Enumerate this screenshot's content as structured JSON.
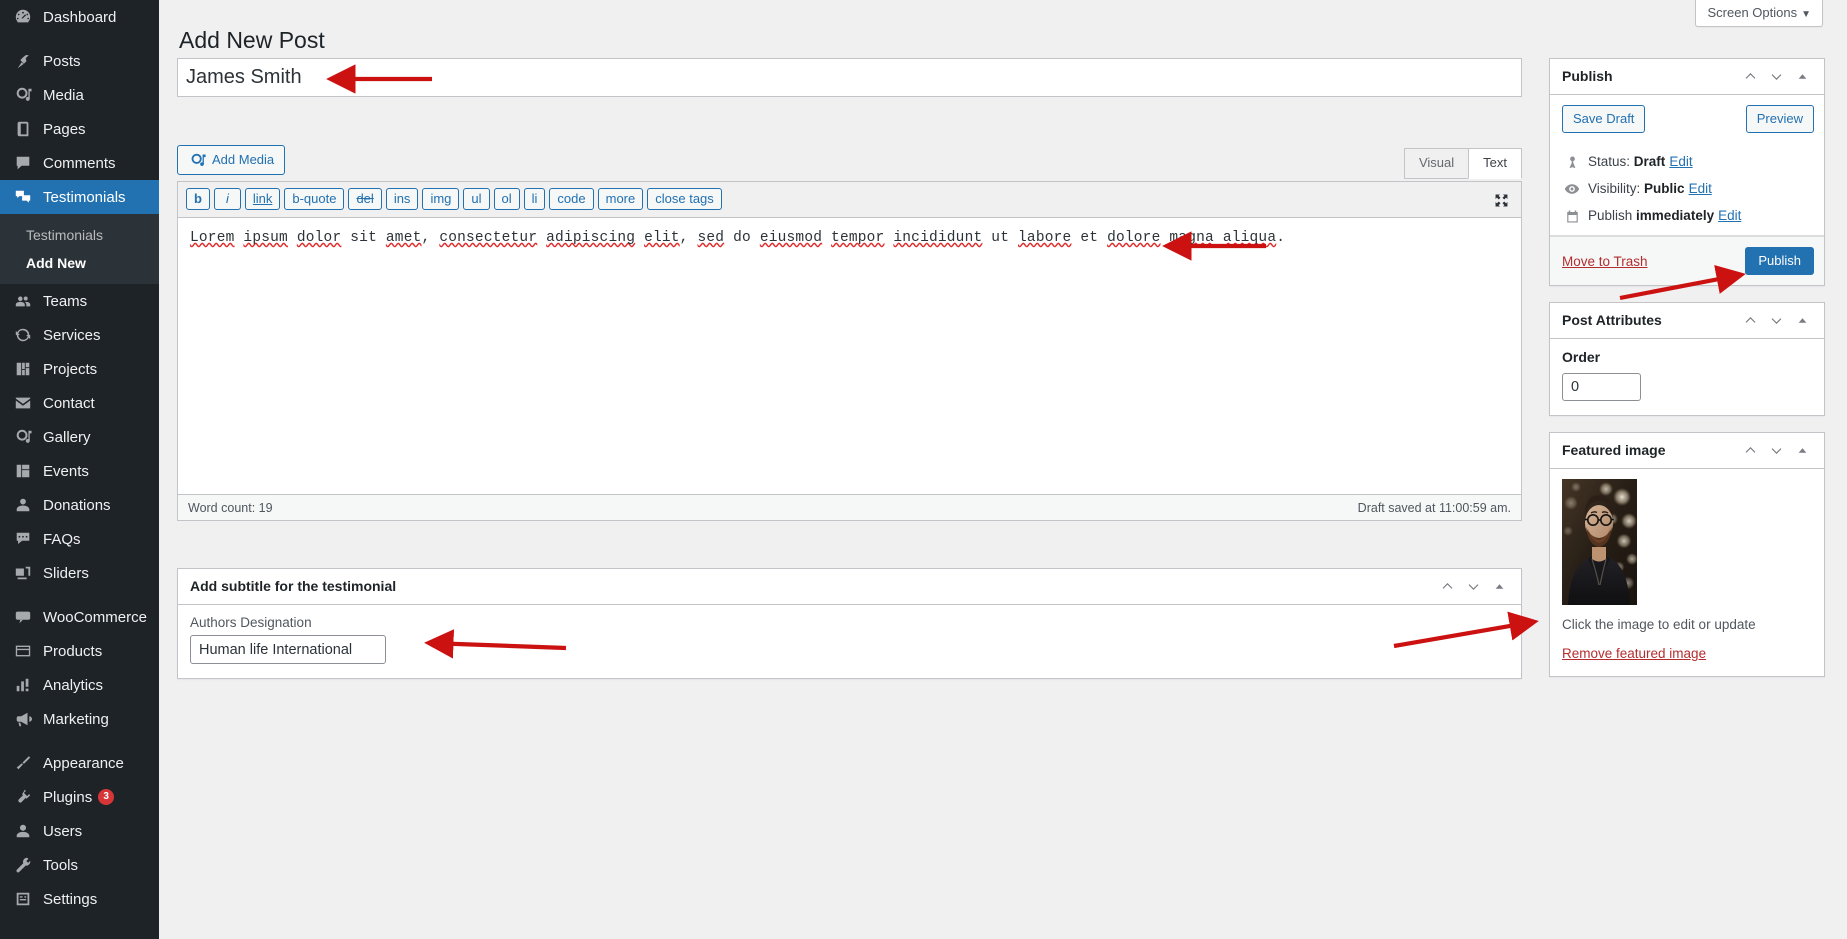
{
  "colors": {
    "sidebar_bg": "#1d2327",
    "submenu_bg": "#2c3338",
    "accent_blue": "#2271b1",
    "danger_red": "#b32d2e",
    "badge_red": "#d63638",
    "annotation_red": "#cc1111",
    "page_bg": "#f0f0f1"
  },
  "sidebar": {
    "items": [
      {
        "label": "Dashboard",
        "icon": "dashboard-icon",
        "current": false
      },
      {
        "sep": true
      },
      {
        "label": "Posts",
        "icon": "pin-icon",
        "current": false
      },
      {
        "label": "Media",
        "icon": "media-icon",
        "current": false
      },
      {
        "label": "Pages",
        "icon": "pages-icon",
        "current": false
      },
      {
        "label": "Comments",
        "icon": "comments-icon",
        "current": false
      },
      {
        "label": "Testimonials",
        "icon": "testimonials-icon",
        "current": true
      },
      {
        "label": "Teams",
        "icon": "teams-icon",
        "current": false
      },
      {
        "label": "Services",
        "icon": "services-icon",
        "current": false
      },
      {
        "label": "Projects",
        "icon": "projects-icon",
        "current": false
      },
      {
        "label": "Contact",
        "icon": "mail-icon",
        "current": false
      },
      {
        "label": "Gallery",
        "icon": "gallery-icon",
        "current": false
      },
      {
        "label": "Events",
        "icon": "events-icon",
        "current": false
      },
      {
        "label": "Donations",
        "icon": "donations-icon",
        "current": false
      },
      {
        "label": "FAQs",
        "icon": "faqs-icon",
        "current": false
      },
      {
        "label": "Sliders",
        "icon": "sliders-icon",
        "current": false
      },
      {
        "sep": true
      },
      {
        "label": "WooCommerce",
        "icon": "woocommerce-icon",
        "current": false
      },
      {
        "label": "Products",
        "icon": "products-icon",
        "current": false
      },
      {
        "label": "Analytics",
        "icon": "analytics-icon",
        "current": false
      },
      {
        "label": "Marketing",
        "icon": "marketing-icon",
        "current": false
      },
      {
        "sep": true
      },
      {
        "label": "Appearance",
        "icon": "appearance-icon",
        "current": false
      },
      {
        "label": "Plugins",
        "icon": "plugins-icon",
        "current": false,
        "badge": "3"
      },
      {
        "label": "Users",
        "icon": "users-icon",
        "current": false
      },
      {
        "label": "Tools",
        "icon": "tools-icon",
        "current": false
      },
      {
        "label": "Settings",
        "icon": "settings-icon",
        "current": false
      }
    ],
    "submenu": {
      "parent": "Testimonials",
      "items": [
        {
          "label": "Testimonials",
          "current": false
        },
        {
          "label": "Add New",
          "current": true
        }
      ]
    }
  },
  "screen_options": {
    "label": "Screen Options",
    "caret": "▼"
  },
  "page": {
    "title": "Add New Post"
  },
  "title_field": {
    "value": "James Smith",
    "placeholder": "Add title"
  },
  "editor": {
    "add_media_label": "Add Media",
    "tabs": [
      {
        "label": "Visual",
        "active": false
      },
      {
        "label": "Text",
        "active": true
      }
    ],
    "quicktags": [
      "b",
      "i",
      "link",
      "b-quote",
      "del",
      "ins",
      "img",
      "ul",
      "ol",
      "li",
      "code",
      "more",
      "close tags"
    ],
    "content": "Lorem ipsum dolor sit amet, consectetur adipiscing elit, sed do eiusmod tempor incididunt ut labore et dolore magna aliqua.",
    "word_count": "Word count: 19",
    "draft_saved": "Draft saved at 11:00:59 am.",
    "fullscreen_icon": "fullscreen-icon"
  },
  "subtitle_box": {
    "title": "Add subtitle for the testimonial",
    "field_label": "Authors Designation",
    "field_value": "Human life International"
  },
  "publish_box": {
    "title": "Publish",
    "save_draft_label": "Save Draft",
    "preview_label": "Preview",
    "status_label": "Status:",
    "status_value": "Draft",
    "status_edit": "Edit",
    "visibility_label": "Visibility:",
    "visibility_value": "Public",
    "visibility_edit": "Edit",
    "publish_label": "Publish",
    "publish_value": "immediately",
    "publish_edit": "Edit",
    "trash_label": "Move to Trash",
    "publish_button": "Publish"
  },
  "post_attributes": {
    "title": "Post Attributes",
    "order_label": "Order",
    "order_value": "0"
  },
  "featured_image": {
    "title": "Featured image",
    "hint": "Click the image to edit or update",
    "remove_label": "Remove featured image",
    "alt": "portrait of bearded man with glasses in front of bokeh lights"
  },
  "annotations": [
    {
      "name": "arrow-to-title",
      "target": "title-field"
    },
    {
      "name": "arrow-to-content",
      "target": "editor-content"
    },
    {
      "name": "arrow-to-publish-button",
      "target": "publish-button"
    },
    {
      "name": "arrow-to-subtitle-field",
      "target": "authors-designation-field"
    },
    {
      "name": "arrow-to-featured-image",
      "target": "featured-image-panel"
    }
  ]
}
